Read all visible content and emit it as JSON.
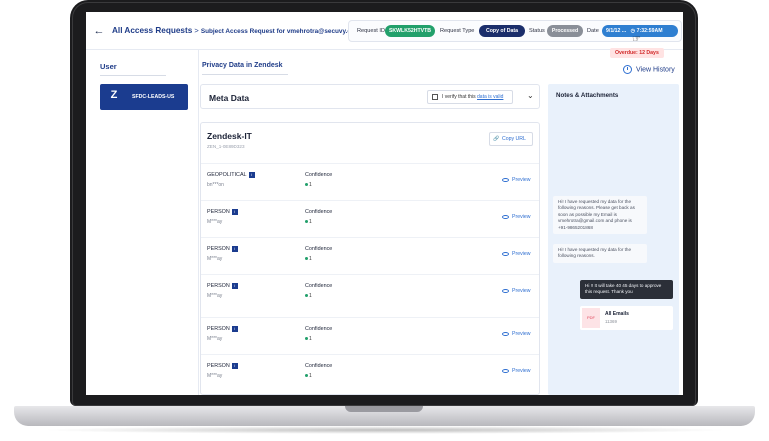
{
  "header": {
    "breadcrumb_main": "All Access Requests",
    "breadcrumb_sep": " > ",
    "breadcrumb_sub": "Subject Access Request for vmehrotra@secuvy.com",
    "request_id_label": "Request ID",
    "request_id_value": "SKWLK52HTVTB",
    "request_type_label": "Request Type",
    "request_type_value": "Copy of Data",
    "status_label": "Status",
    "status_value": "Processed",
    "date_label": "Date",
    "date_value": "9/1/12 ...",
    "time_value": "7:32:59AM",
    "overdue": "Overdue: 12 Days"
  },
  "sidebar": {
    "heading": "User",
    "system_label": "SFDC-LEADS-US",
    "logo_text": "Z"
  },
  "main": {
    "title": "Privacy Data in Zendesk",
    "view_history": "View History",
    "meta_title": "Meta Data",
    "verify_text": "I verify that this ",
    "verify_link": "data is valid",
    "source_name": "Zendesk-IT",
    "source_id": "ZEN_1-0E89D323",
    "copy_url": "Copy URL",
    "confidence_label": "Confidence",
    "preview_label": "Preview",
    "rows": [
      {
        "type": "GEOPOLITICAL",
        "value": "bn***on",
        "confidence": "1"
      },
      {
        "type": "PERSON",
        "value": "M***ay",
        "confidence": "1"
      },
      {
        "type": "PERSON",
        "value": "M***ay",
        "confidence": "1"
      },
      {
        "type": "PERSON",
        "value": "M***ay",
        "confidence": "1"
      },
      {
        "type": "PERSON",
        "value": "M***ay",
        "confidence": "1"
      },
      {
        "type": "PERSON",
        "value": "M***ay",
        "confidence": "1"
      }
    ]
  },
  "notes": {
    "title": "Notes & Attachments",
    "messages": [
      "Hi! I have requested my data for the following reasons. Please get back as soon as possible my Email is vmehrotra@gmail.com and phone is +91-9865201868",
      "Hi! I have requested my data for the following reasons.",
      "Hi !! It will take 40 45 days to approve this request. Thank you"
    ],
    "attachment_name": "All Emails",
    "attachment_size": "11369",
    "attachment_type": "PDF"
  },
  "colors": {
    "brand": "#1f3c88",
    "success": "#22a06b",
    "danger": "#d12a2a",
    "notes_bg": "#e9f1fb"
  }
}
